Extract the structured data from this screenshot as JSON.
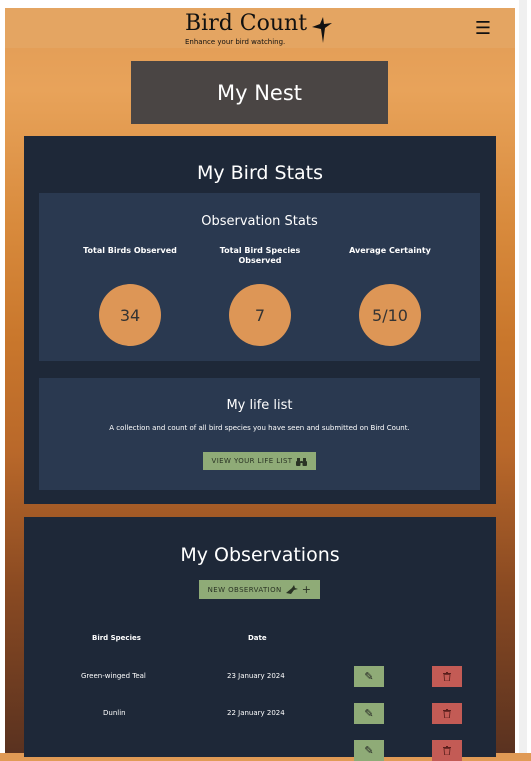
{
  "navbar": {
    "brand": "Bird Count",
    "tagline": "Enhance your bird watching.",
    "menu_icon": "menu-icon"
  },
  "page": {
    "title": "My Nest"
  },
  "stats": {
    "title": "My Bird Stats",
    "observation_stats": {
      "title": "Observation Stats",
      "items": [
        {
          "label": "Total Birds Observed",
          "value": "34"
        },
        {
          "label": "Total Bird Species Observed",
          "value": "7"
        },
        {
          "label": "Average Certainty",
          "value": "5/10"
        }
      ]
    },
    "life_list": {
      "title": "My life list",
      "description": "A collection and count of all bird species you have seen and submitted on Bird Count.",
      "button": "VIEW YOUR LIFE LIST"
    }
  },
  "observations": {
    "title": "My Observations",
    "new_button": "NEW OBSERVATION",
    "columns": [
      "Bird Species",
      "Date"
    ],
    "rows": [
      {
        "species": "Green-winged Teal",
        "date": "23 January 2024"
      },
      {
        "species": "Dunlin",
        "date": "22 January 2024"
      }
    ]
  }
}
